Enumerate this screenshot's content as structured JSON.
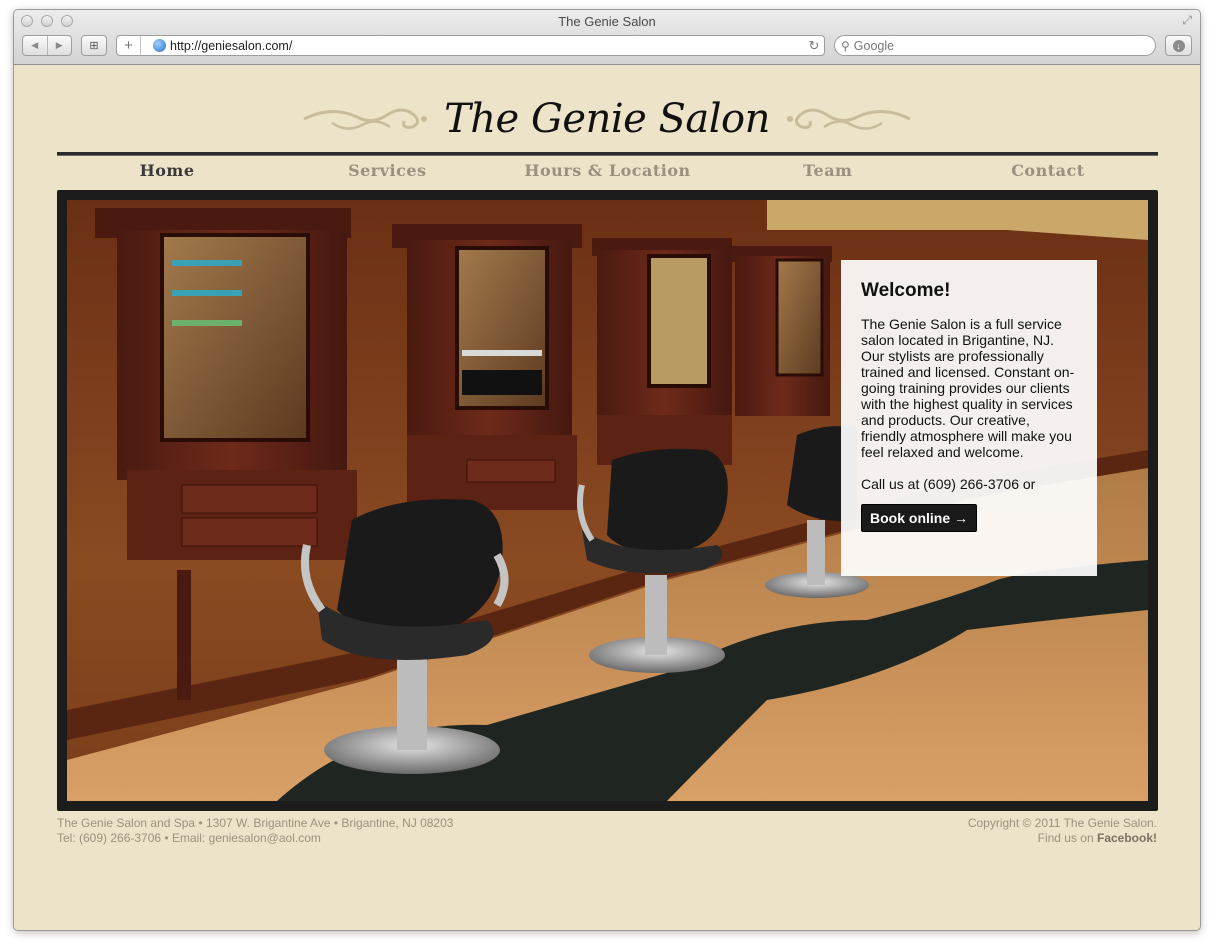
{
  "browser": {
    "window_title": "The Genie Salon",
    "url": "http://geniesalon.com/",
    "search_placeholder": "Google"
  },
  "site": {
    "title": "The Genie Salon",
    "nav": [
      {
        "label": "Home",
        "active": true
      },
      {
        "label": "Services",
        "active": false
      },
      {
        "label": "Hours & Location",
        "active": false
      },
      {
        "label": "Team",
        "active": false
      },
      {
        "label": "Contact",
        "active": false
      }
    ]
  },
  "welcome": {
    "heading": "Welcome!",
    "body": "The Genie Salon is a full service salon located in Brigantine, NJ. Our stylists are professionally trained and licensed. Constant on-going training provides our clients with the highest quality in services and products. Our creative, friendly atmosphere will make you feel relaxed and welcome.",
    "call": "Call us at (609) 266-3706 or",
    "book_label": "Book online →"
  },
  "footer": {
    "address_line": "The Genie Salon and Spa • 1307 W. Brigantine Ave • Brigantine, NJ 08203",
    "contact_line": "Tel: (609) 266-3706 • Email: geniesalon@aol.com",
    "copyright": "Copyright © 2011 The Genie Salon.",
    "find_us": "Find us on ",
    "facebook": "Facebook!"
  },
  "colors": {
    "page_bg": "#ede3c8",
    "frame": "#1c1c1c",
    "nav_active": "#3a3a3a",
    "nav_inactive": "#9a907d"
  }
}
